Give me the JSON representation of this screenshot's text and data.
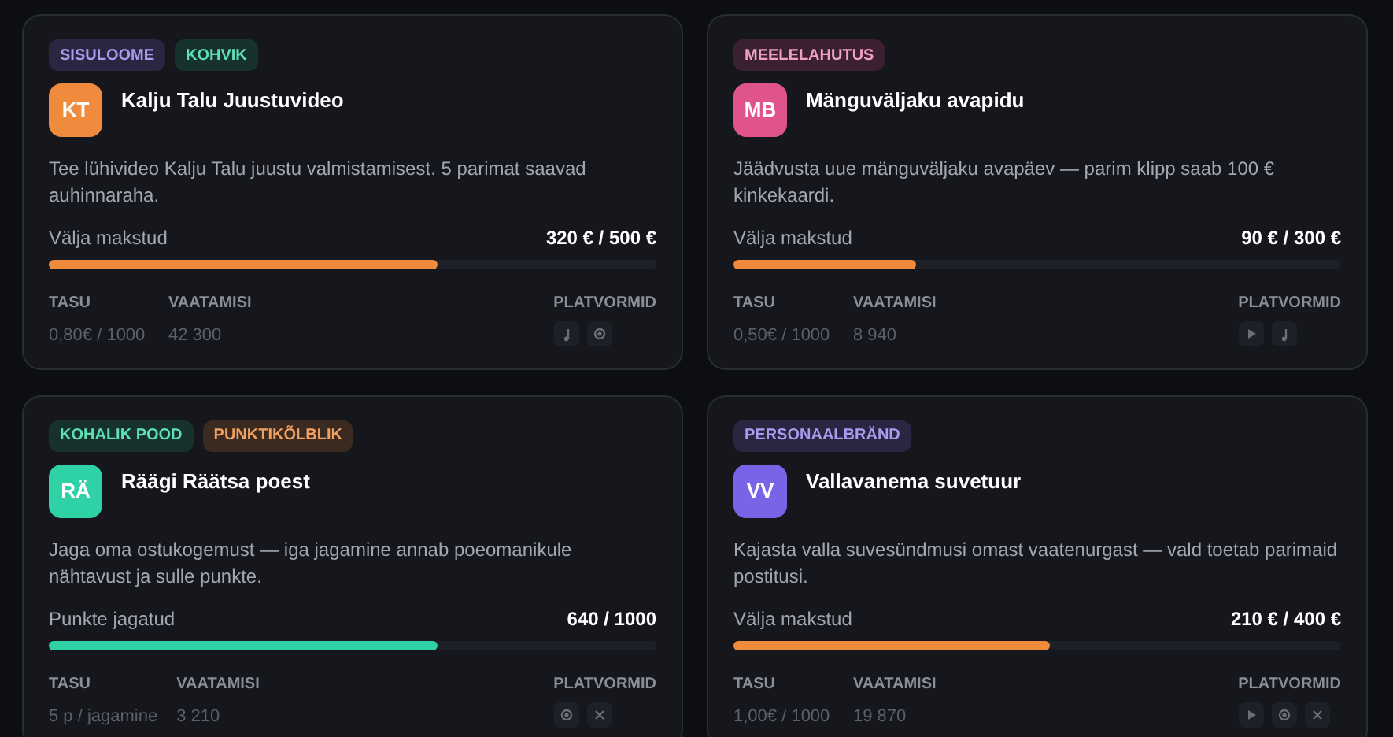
{
  "cards": [
    {
      "tags": [
        {
          "label": "SISULOOME",
          "kind": "violet"
        },
        {
          "label": "KOHVIK",
          "kind": "teal"
        }
      ],
      "initials": "KT",
      "color": "#f08a3c",
      "title": "Kalju Talu Juustuvideo",
      "description": "Tee lühivideo Kalju Talu juustu valmistamisest. 5 parimat saavad auhinnaraha.",
      "progress": {
        "kind": "money",
        "label": "Välja makstud",
        "value": "320 € / 500 €",
        "level": 0.64
      },
      "stats": [
        {
          "label": "TASU",
          "value": "0,80€ / 1000"
        },
        {
          "label": "VAATAMISI",
          "value": "42 300"
        }
      ],
      "platforms_label": "PLATVORMID",
      "platforms": [
        {
          "kind": "note"
        },
        {
          "kind": "record"
        }
      ]
    },
    {
      "tags": [
        {
          "label": "MEELELAHUTUS",
          "kind": "pink"
        }
      ],
      "initials": "MB",
      "color": "#e0548e",
      "title": "Mänguväljaku avapidu",
      "description": "Jäädvusta uue mänguväljaku avapäev — parim klipp saab 100 € kinkekaardi.",
      "progress": {
        "kind": "money",
        "label": "Välja makstud",
        "value": "90 € / 300 €",
        "level": 0.3
      },
      "stats": [
        {
          "label": "TASU",
          "value": "0,50€ / 1000"
        },
        {
          "label": "VAATAMISI",
          "value": "8 940"
        }
      ],
      "platforms_label": "PLATVORMID",
      "platforms": [
        {
          "kind": "play"
        },
        {
          "kind": "note"
        }
      ]
    },
    {
      "tags": [
        {
          "label": "KOHALIK POOD",
          "kind": "teal"
        },
        {
          "label": "PUNKTIKÕLBLIK",
          "kind": "orange"
        }
      ],
      "initials": "RÄ",
      "color": "#2fd1a6",
      "title": "Räägi Räätsa poest",
      "description": "Jaga oma ostukogemust — iga jagamine annab poeomanikule nähtavust ja sulle punkte.",
      "progress": {
        "kind": "points",
        "label": "Punkte jagatud",
        "value": "640 / 1000",
        "level": 0.64
      },
      "stats": [
        {
          "label": "TASU",
          "value": "5 p / jagamine"
        },
        {
          "label": "VAATAMISI",
          "value": "3 210"
        }
      ],
      "platforms_label": "PLATVORMID",
      "platforms": [
        {
          "kind": "record"
        },
        {
          "kind": "cross"
        }
      ]
    },
    {
      "tags": [
        {
          "label": "PERSONAALBRÄND",
          "kind": "violet"
        }
      ],
      "initials": "VV",
      "color": "#7b63e8",
      "title": "Vallavanema suvetuur",
      "description": "Kajasta valla suvesündmusi omast vaatenurgast — vald toetab parimaid postitusi.",
      "progress": {
        "kind": "money",
        "label": "Välja makstud",
        "value": "210 € / 400 €",
        "level": 0.52
      },
      "stats": [
        {
          "label": "TASU",
          "value": "1,00€ / 1000"
        },
        {
          "label": "VAATAMISI",
          "value": "19 870"
        }
      ],
      "platforms_label": "PLATVORMID",
      "platforms": [
        {
          "kind": "play"
        },
        {
          "kind": "record"
        },
        {
          "kind": "cross"
        }
      ]
    }
  ]
}
